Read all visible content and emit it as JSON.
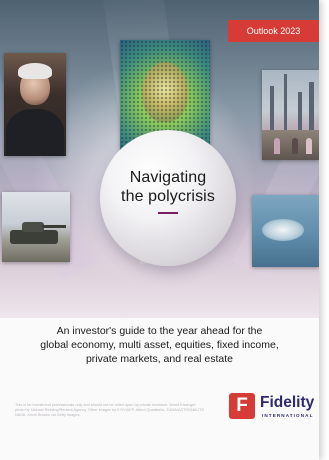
{
  "badge": {
    "text": "Outlook 2023"
  },
  "cover": {
    "title_line1": "Navigating",
    "title_line2": "the polycrisis"
  },
  "subtitle": {
    "line1": "An investor's guide to the year ahead for the",
    "line2": "global economy, multi asset, equities, fixed income,",
    "line3": "private markets, and real estate"
  },
  "disclaimer": {
    "text": "This is for investment professionals only and should not be relied upon by private investors. World Kissinger photo by Michael Reibling/Reuters Agency. Other images by KYIV/AFP, Alford Quartbello, ZUMA/ASTRONAUTS NASA, Kevin Brooks via Getty Images."
  },
  "brand": {
    "mark": "F",
    "name": "Fidelity",
    "tagline": "INTERNATIONAL",
    "accent_color": "#d63b35",
    "navy_color": "#2d2a6e",
    "rule_color": "#7b1e63"
  },
  "icons": [
    "fidelity-f-logo-icon"
  ]
}
